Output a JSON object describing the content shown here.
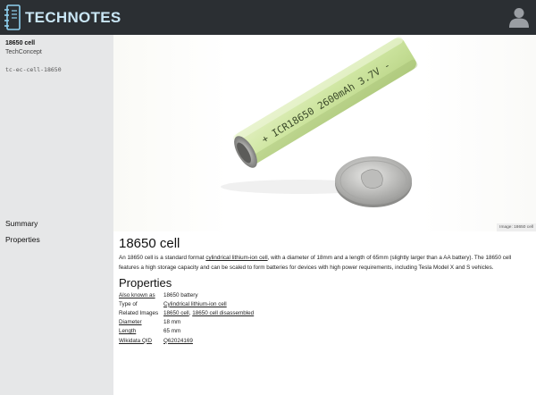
{
  "header": {
    "brand": "TECHNOTES"
  },
  "sidebar": {
    "title": "18650 cell",
    "subtitle": "TechConcept",
    "id": "tc-ec-cell-18650",
    "links": [
      "Summary",
      "Properties"
    ]
  },
  "hero": {
    "battery_text": "+ ICR18650 2600mAh 3.7V -",
    "caption": "Image: 18650 cell"
  },
  "article": {
    "title": "18650 cell",
    "intro_before": "An 18650 cell is a standard format ",
    "intro_link": "cylindrical lithium-ion cell",
    "intro_after": ", with a diameter of 18mm and a length of 65mm (slightly larger than a AA battery). The 18650 cell features a high storage capacity and can be scaled to form batteries for devices with high power requirements, including Tesla Model X and S vehicles.",
    "properties_heading": "Properties",
    "properties": [
      {
        "label": "Also known as",
        "value": "18650 battery"
      },
      {
        "label": "Type of",
        "value": "Cylindrical lithium-ion cell"
      },
      {
        "label": "Related Images",
        "value": "18650 cell",
        "value2": "18650 cell disassembled"
      },
      {
        "label": "Diameter",
        "value": "18 mm"
      },
      {
        "label": "Length",
        "value": "65 mm"
      },
      {
        "label": "Wikidata QID",
        "value": "Q62024169"
      }
    ]
  },
  "colors": {
    "topbar": "#2b2f33",
    "brand_text": "#c9e6f5",
    "sidebar_bg": "#e6e7e8",
    "battery_wrap": "#c9e39a"
  }
}
